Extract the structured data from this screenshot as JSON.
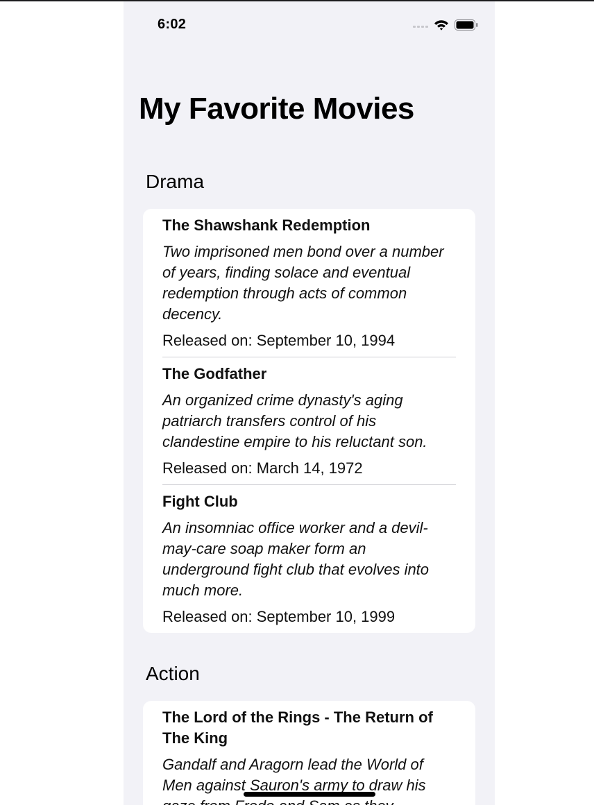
{
  "status_bar": {
    "time": "6:02",
    "signal_icon": "cellular-signal-icon",
    "wifi_icon": "wifi-icon",
    "battery_icon": "battery-icon"
  },
  "page": {
    "title": "My Favorite Movies"
  },
  "sections": [
    {
      "header": "Drama",
      "movies": [
        {
          "title": "The Shawshank Redemption",
          "description": "Two imprisoned men bond over a number of years, finding solace and eventual redemption through acts of common decency.",
          "release": "Released on: September 10, 1994"
        },
        {
          "title": "The Godfather",
          "description": "An organized crime dynasty's aging patriarch transfers control of his clandestine empire to his reluctant son.",
          "release": "Released on: March 14, 1972"
        },
        {
          "title": "Fight Club",
          "description": "An insomniac office worker and a devil-may-care soap maker form an underground fight club that evolves into much more.",
          "release": "Released on: September 10, 1999"
        }
      ]
    },
    {
      "header": "Action",
      "movies": [
        {
          "title": "The Lord of the Rings - The Return of The King",
          "description": "Gandalf and Aragorn lead the World of Men against Sauron's army to draw his gaze from Frodo and Sam as they"
        }
      ]
    }
  ],
  "colors": {
    "background": "#f2f2f7",
    "card": "#ffffff",
    "separator": "#cfcfd4",
    "text": "#111111"
  }
}
